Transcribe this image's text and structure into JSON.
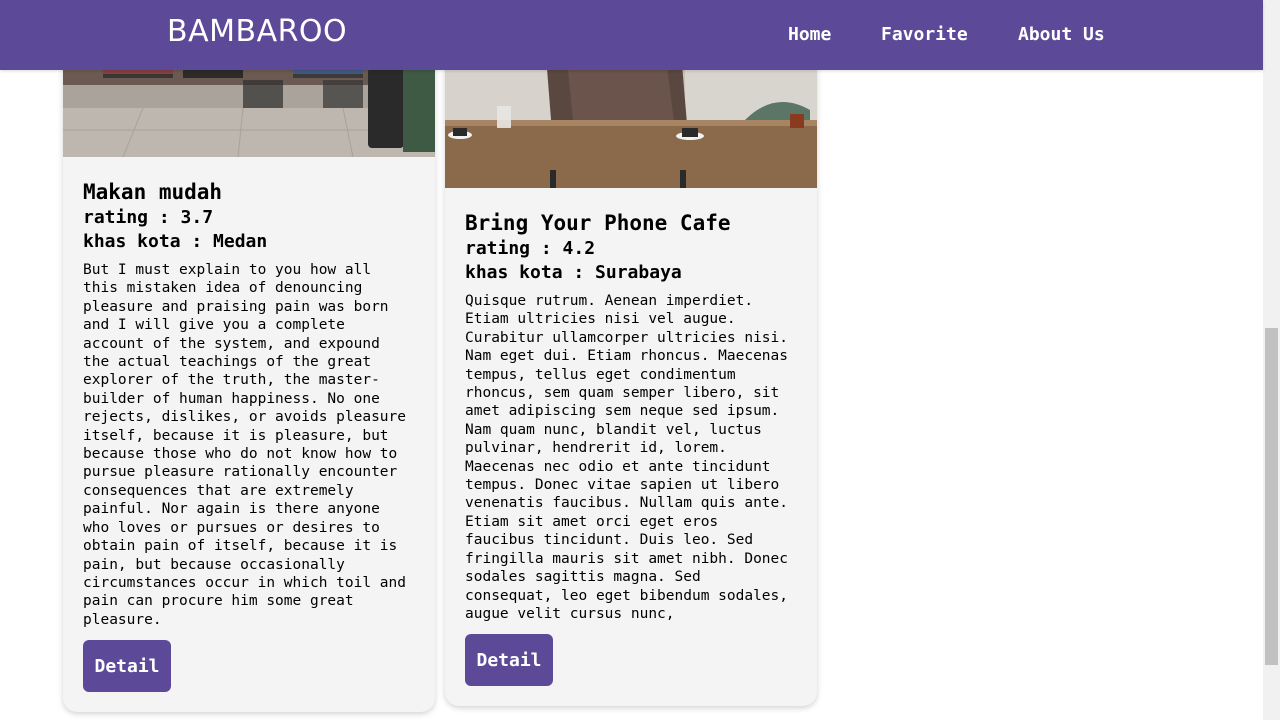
{
  "navbar": {
    "brand": "BAMBAROO",
    "links": [
      "Home",
      "Favorite",
      "About Us"
    ]
  },
  "cards": [
    {
      "title": "Makan mudah",
      "rating": "rating : 3.7",
      "city": "khas kota : Medan",
      "description": "But I must explain to you how all this mistaken idea of denouncing pleasure and praising pain was born and I will give you a complete account of the system, and expound the actual teachings of the great explorer of the truth, the master-builder of human happiness. No one rejects, dislikes, or avoids pleasure itself, because it is pleasure, but because those who do not know how to pursue pleasure rationally encounter consequences that are extremely painful. Nor again is there anyone who loves or pursues or desires to obtain pain of itself, because it is pain, but because occasionally circumstances occur in which toil and pain can procure him some great pleasure.",
      "button": "Detail"
    },
    {
      "title": "Bring Your Phone Cafe",
      "rating": "rating : 4.2",
      "city": "khas kota : Surabaya",
      "description": "Quisque rutrum. Aenean imperdiet. Etiam ultricies nisi vel augue. Curabitur ullamcorper ultricies nisi. Nam eget dui. Etiam rhoncus. Maecenas tempus, tellus eget condimentum rhoncus, sem quam semper libero, sit amet adipiscing sem neque sed ipsum. Nam quam nunc, blandit vel, luctus pulvinar, hendrerit id, lorem. Maecenas nec odio et ante tincidunt tempus. Donec vitae sapien ut libero venenatis faucibus. Nullam quis ante. Etiam sit amet orci eget eros faucibus tincidunt. Duis leo. Sed fringilla mauris sit amet nibh. Donec sodales sagittis magna. Sed consequat, leo eget bibendum sodales, augue velit cursus nunc,",
      "button": "Detail"
    }
  ],
  "colors": {
    "primary": "#5c4a99",
    "card_bg": "#f4f4f4"
  }
}
